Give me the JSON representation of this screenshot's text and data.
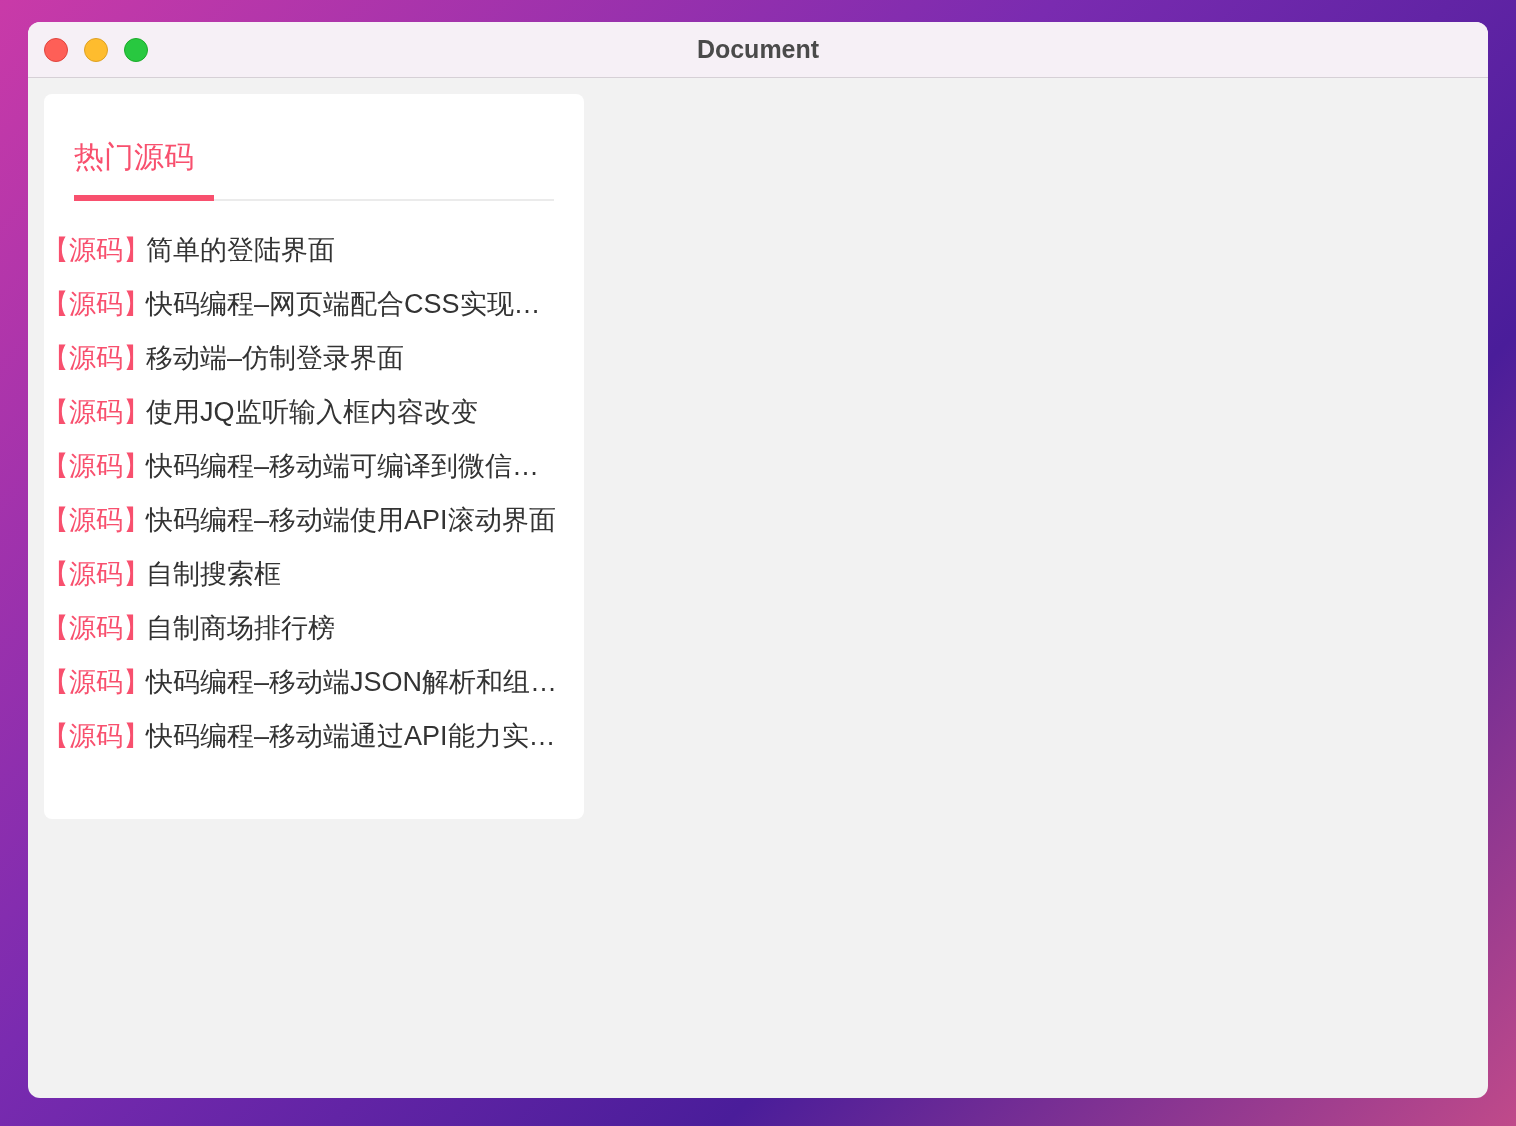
{
  "window": {
    "title": "Document"
  },
  "tabs": [
    {
      "label": "热门源码",
      "selected": true
    }
  ],
  "items": [
    {
      "tag": "【源码】",
      "title": "简单的登陆界面"
    },
    {
      "tag": "【源码】",
      "title": "快码编程–网页端配合CSS实现…"
    },
    {
      "tag": "【源码】",
      "title": "移动端–仿制登录界面"
    },
    {
      "tag": "【源码】",
      "title": "使用JQ监听输入框内容改变"
    },
    {
      "tag": "【源码】",
      "title": "快码编程–移动端可编译到微信…"
    },
    {
      "tag": "【源码】",
      "title": "快码编程–移动端使用API滚动界面"
    },
    {
      "tag": "【源码】",
      "title": "自制搜索框"
    },
    {
      "tag": "【源码】",
      "title": "自制商场排行榜"
    },
    {
      "tag": "【源码】",
      "title": "快码编程–移动端JSON解析和组…"
    },
    {
      "tag": "【源码】",
      "title": "快码编程–移动端通过API能力实…"
    }
  ]
}
